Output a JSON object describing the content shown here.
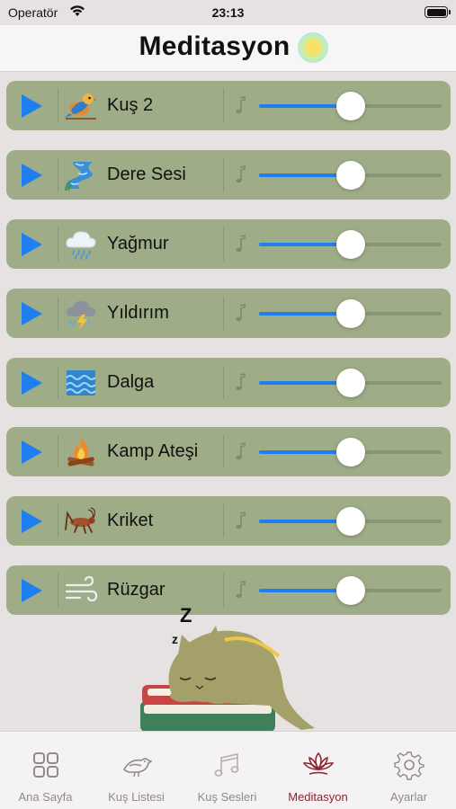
{
  "status": {
    "carrier": "Operatör",
    "time": "23:13"
  },
  "header": {
    "title": "Meditasyon",
    "icon": "sun-icon"
  },
  "sounds": [
    {
      "name": "Kuş 2",
      "icon": "bird-icon",
      "volume": 0.5
    },
    {
      "name": "Dere Sesi",
      "icon": "stream-icon",
      "volume": 0.5
    },
    {
      "name": "Yağmur",
      "icon": "rain-cloud-icon",
      "volume": 0.5
    },
    {
      "name": "Yıldırım",
      "icon": "thunderstorm-icon",
      "volume": 0.5
    },
    {
      "name": "Dalga",
      "icon": "wave-icon",
      "volume": 0.5
    },
    {
      "name": "Kamp Ateşi",
      "icon": "campfire-icon",
      "volume": 0.5
    },
    {
      "name": "Kriket",
      "icon": "cricket-icon",
      "volume": 0.5
    },
    {
      "name": "Rüzgar",
      "icon": "wind-icon",
      "volume": 0.5
    }
  ],
  "illustration": {
    "sleep_text_large": "Z",
    "sleep_text_small": "z"
  },
  "tabs": [
    {
      "label": "Ana Sayfa",
      "icon": "grid-icon",
      "active": false
    },
    {
      "label": "Kuş Listesi",
      "icon": "bird-outline-icon",
      "active": false
    },
    {
      "label": "Kuş Sesleri",
      "icon": "music-notes-icon",
      "active": false
    },
    {
      "label": "Meditasyon",
      "icon": "lotus-icon",
      "active": true
    },
    {
      "label": "Ayarlar",
      "icon": "gear-icon",
      "active": false
    }
  ],
  "colors": {
    "accent": "#1f7ff1",
    "row_bg": "#9ead87",
    "active_tab": "#8c2331"
  }
}
